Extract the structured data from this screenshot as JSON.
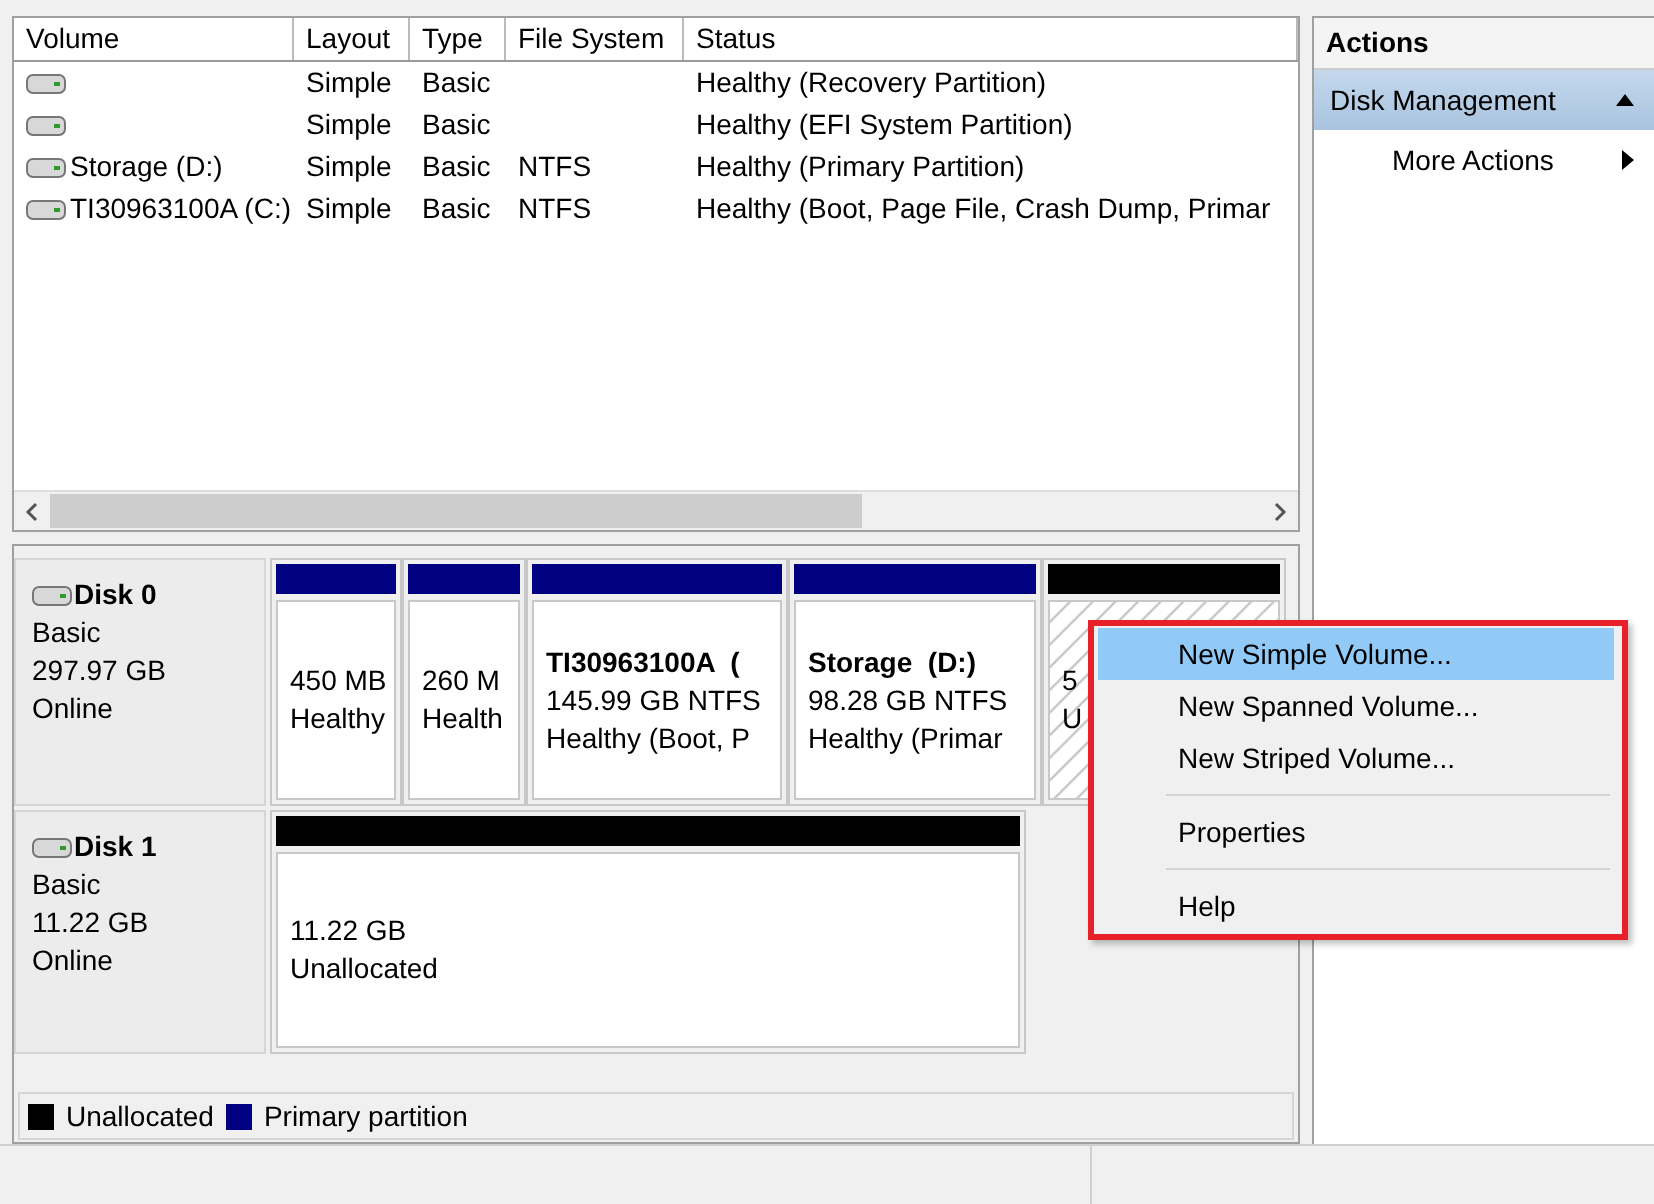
{
  "volume_list": {
    "columns": [
      "Volume",
      "Layout",
      "Type",
      "File System",
      "Status"
    ],
    "rows": [
      {
        "layout": "Simple",
        "type": "Basic",
        "status": "Healthy (Recovery Partition)"
      },
      {
        "layout": "Simple",
        "type": "Basic",
        "status": "Healthy (EFI System Partition)"
      },
      {
        "volume": "Storage (D:)",
        "layout": "Simple",
        "type": "Basic",
        "file_system": "NTFS",
        "status": "Healthy (Primary Partition)"
      },
      {
        "volume": "TI30963100A (C:)",
        "layout": "Simple",
        "type": "Basic",
        "file_system": "NTFS",
        "status": "Healthy (Boot, Page File, Crash Dump, Primar"
      }
    ]
  },
  "disks": [
    {
      "name": "Disk 0",
      "type": "Basic",
      "size": "297.97 GB",
      "status": "Online",
      "partitions": [
        {
          "kind": "primary",
          "lines": [
            "450 MB",
            "Healthy"
          ]
        },
        {
          "kind": "primary",
          "lines": [
            "260 M",
            "Health"
          ]
        },
        {
          "kind": "primary",
          "title": "TI30963100A  (",
          "lines": [
            "145.99 GB NTFS",
            "Healthy (Boot, P"
          ]
        },
        {
          "kind": "primary",
          "title": "Storage  (D:)",
          "lines": [
            "98.28 GB NTFS",
            "Healthy (Primar"
          ]
        },
        {
          "kind": "unallocated",
          "lines": [
            "5",
            "U"
          ]
        }
      ]
    },
    {
      "name": "Disk 1",
      "type": "Basic",
      "size": "11.22 GB",
      "status": "Online",
      "partitions": [
        {
          "kind": "unallocated",
          "lines": [
            "11.22 GB",
            "Unallocated"
          ]
        }
      ]
    }
  ],
  "legend": [
    {
      "label": "Unallocated",
      "color": "#000000"
    },
    {
      "label": "Primary partition",
      "color": "#000080"
    }
  ],
  "context_menu": [
    {
      "kind": "item",
      "label": "New Simple Volume...",
      "selected": true
    },
    {
      "kind": "item",
      "label": "New Spanned Volume...",
      "selected": false
    },
    {
      "kind": "item",
      "label": "New Striped Volume...",
      "selected": false
    },
    {
      "kind": "separator"
    },
    {
      "kind": "item",
      "label": "Properties",
      "selected": false
    },
    {
      "kind": "separator"
    },
    {
      "kind": "item",
      "label": "Help",
      "selected": false
    }
  ],
  "actions": {
    "title": "Actions",
    "section": {
      "label": "Disk Management",
      "expanded": true
    },
    "items": [
      {
        "label": "More Actions"
      }
    ]
  }
}
